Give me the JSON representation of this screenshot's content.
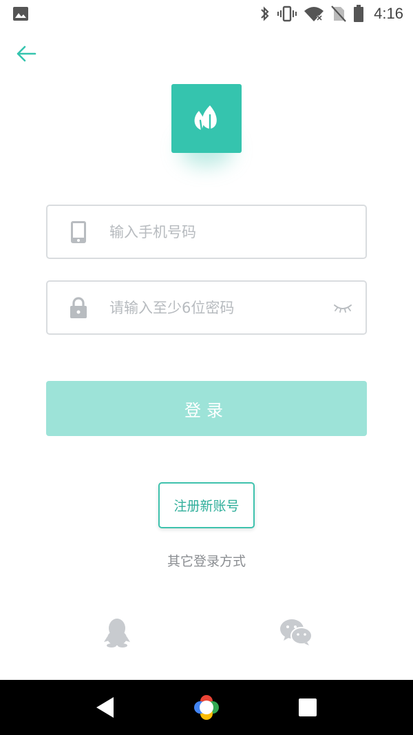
{
  "status_bar": {
    "time": "4:16",
    "icons": [
      "image-icon",
      "bluetooth-icon",
      "vibrate-icon",
      "wifi-icon",
      "no-sim-icon",
      "battery-icon"
    ]
  },
  "header": {
    "back_icon": "arrow-left-icon",
    "accent_color": "#35c4ae"
  },
  "logo": {
    "icon": "leaf-icon",
    "background_color": "#35c4ae"
  },
  "form": {
    "phone": {
      "placeholder": "输入手机号码",
      "value": "",
      "icon": "phone-icon"
    },
    "password": {
      "placeholder": "请输入至少6位密码",
      "value": "",
      "icon": "lock-icon",
      "toggle_icon": "eye-closed-icon"
    },
    "login_label": "登录",
    "login_color": "#9de3d8"
  },
  "register_label": "注册新账号",
  "other_login": {
    "label": "其它登录方式",
    "providers": [
      "qq-icon",
      "wechat-icon"
    ]
  },
  "nav_bar": {
    "buttons": [
      "back-triangle-icon",
      "home-icon",
      "recents-icon"
    ]
  }
}
